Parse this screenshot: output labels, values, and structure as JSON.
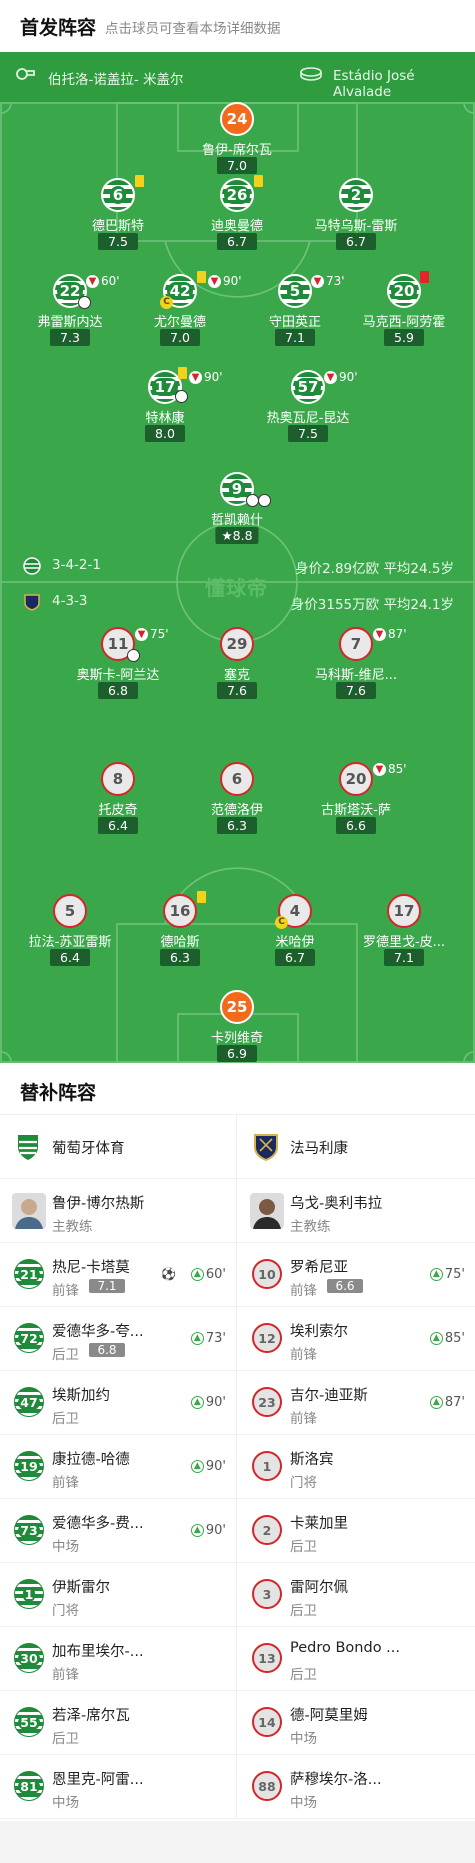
{
  "header": {
    "title": "首发阵容",
    "subtitle": "点击球员可查看本场详细数据"
  },
  "match": {
    "referee": "伯托洛-诺盖拉- 米盖尔",
    "stadium": "Estádio José Alvalade"
  },
  "home_team": {
    "formation": "3-4-2-1",
    "value": "身价2.89亿欧",
    "avg_age": "平均24.5岁"
  },
  "away_team": {
    "formation": "4-3-3",
    "value": "身价3155万欧",
    "avg_age": "平均24.1岁"
  },
  "watermark": "懂球帝",
  "home_players": [
    {
      "num": "24",
      "name": "鲁伊-席尔瓦",
      "rating": "7.0"
    },
    {
      "num": "6",
      "name": "德巴斯特",
      "rating": "7.5"
    },
    {
      "num": "26",
      "name": "迪奥曼德",
      "rating": "6.7"
    },
    {
      "num": "2",
      "name": "马特乌斯-雷斯",
      "rating": "6.7"
    },
    {
      "num": "22",
      "name": "弗雷斯内达",
      "rating": "7.3",
      "event": "60'"
    },
    {
      "num": "42",
      "name": "尤尔曼德",
      "rating": "7.0",
      "event": "90'"
    },
    {
      "num": "5",
      "name": "守田英正",
      "rating": "7.1",
      "event": "73'"
    },
    {
      "num": "20",
      "name": "马克西-阿劳霍",
      "rating": "5.9"
    },
    {
      "num": "17",
      "name": "特林康",
      "rating": "8.0",
      "event": "90'"
    },
    {
      "num": "57",
      "name": "热奥瓦尼-昆达",
      "rating": "7.5",
      "event": "90'"
    },
    {
      "num": "9",
      "name": "哲凯赖什",
      "rating": "8.8"
    }
  ],
  "away_players": [
    {
      "num": "11",
      "name": "奥斯卡-阿兰达",
      "rating": "6.8",
      "event": "75'"
    },
    {
      "num": "29",
      "name": "塞克",
      "rating": "7.6"
    },
    {
      "num": "7",
      "name": "马科斯-维尼...",
      "rating": "7.6",
      "event": "87'"
    },
    {
      "num": "8",
      "name": "托皮奇",
      "rating": "6.4"
    },
    {
      "num": "6",
      "name": "范德洛伊",
      "rating": "6.3"
    },
    {
      "num": "20",
      "name": "古斯塔沃-萨",
      "rating": "6.6",
      "event": "85'"
    },
    {
      "num": "5",
      "name": "拉法-苏亚雷斯",
      "rating": "6.4"
    },
    {
      "num": "16",
      "name": "德哈斯",
      "rating": "6.3"
    },
    {
      "num": "4",
      "name": "米哈伊",
      "rating": "6.7"
    },
    {
      "num": "17",
      "name": "罗德里戈-皮...",
      "rating": "7.1"
    },
    {
      "num": "25",
      "name": "卡列维奇",
      "rating": "6.9"
    }
  ],
  "subs": {
    "title": "替补阵容",
    "home": {
      "team": "葡萄牙体育",
      "coach": {
        "name": "鲁伊-博尔热斯",
        "role": "主教练"
      },
      "players": [
        {
          "num": "21",
          "name": "热尼-卡塔莫",
          "pos": "前锋",
          "rating": "7.1",
          "in": "60'"
        },
        {
          "num": "72",
          "name": "爱德华多-夸...",
          "pos": "后卫",
          "rating": "6.8",
          "in": "73'"
        },
        {
          "num": "47",
          "name": "埃斯加约",
          "pos": "后卫",
          "in": "90'"
        },
        {
          "num": "19",
          "name": "康拉德-哈德",
          "pos": "前锋",
          "in": "90'"
        },
        {
          "num": "73",
          "name": "爱德华多-费...",
          "pos": "中场",
          "in": "90'"
        },
        {
          "num": "1",
          "name": "伊斯雷尔",
          "pos": "门将"
        },
        {
          "num": "30",
          "name": "加布里埃尔-...",
          "pos": "前锋"
        },
        {
          "num": "55",
          "name": "若泽-席尔瓦",
          "pos": "后卫"
        },
        {
          "num": "81",
          "name": "恩里克-阿雷...",
          "pos": "中场"
        }
      ]
    },
    "away": {
      "team": "法马利康",
      "coach": {
        "name": "乌戈-奥利韦拉",
        "role": "主教练"
      },
      "players": [
        {
          "num": "10",
          "name": "罗希尼亚",
          "pos": "前锋",
          "rating": "6.6",
          "in": "75'"
        },
        {
          "num": "12",
          "name": "埃利索尔",
          "pos": "前锋",
          "in": "85'"
        },
        {
          "num": "23",
          "name": "吉尔-迪亚斯",
          "pos": "前锋",
          "in": "87'"
        },
        {
          "num": "1",
          "name": "斯洛宾",
          "pos": "门将"
        },
        {
          "num": "2",
          "name": "卡莱加里",
          "pos": "后卫"
        },
        {
          "num": "3",
          "name": "雷阿尔佩",
          "pos": "后卫"
        },
        {
          "num": "13",
          "name": "Pedro Bondo ...",
          "pos": "后卫"
        },
        {
          "num": "14",
          "name": "德-阿莫里姆",
          "pos": "中场"
        },
        {
          "num": "88",
          "name": "萨穆埃尔-洛...",
          "pos": "中场"
        }
      ]
    }
  }
}
